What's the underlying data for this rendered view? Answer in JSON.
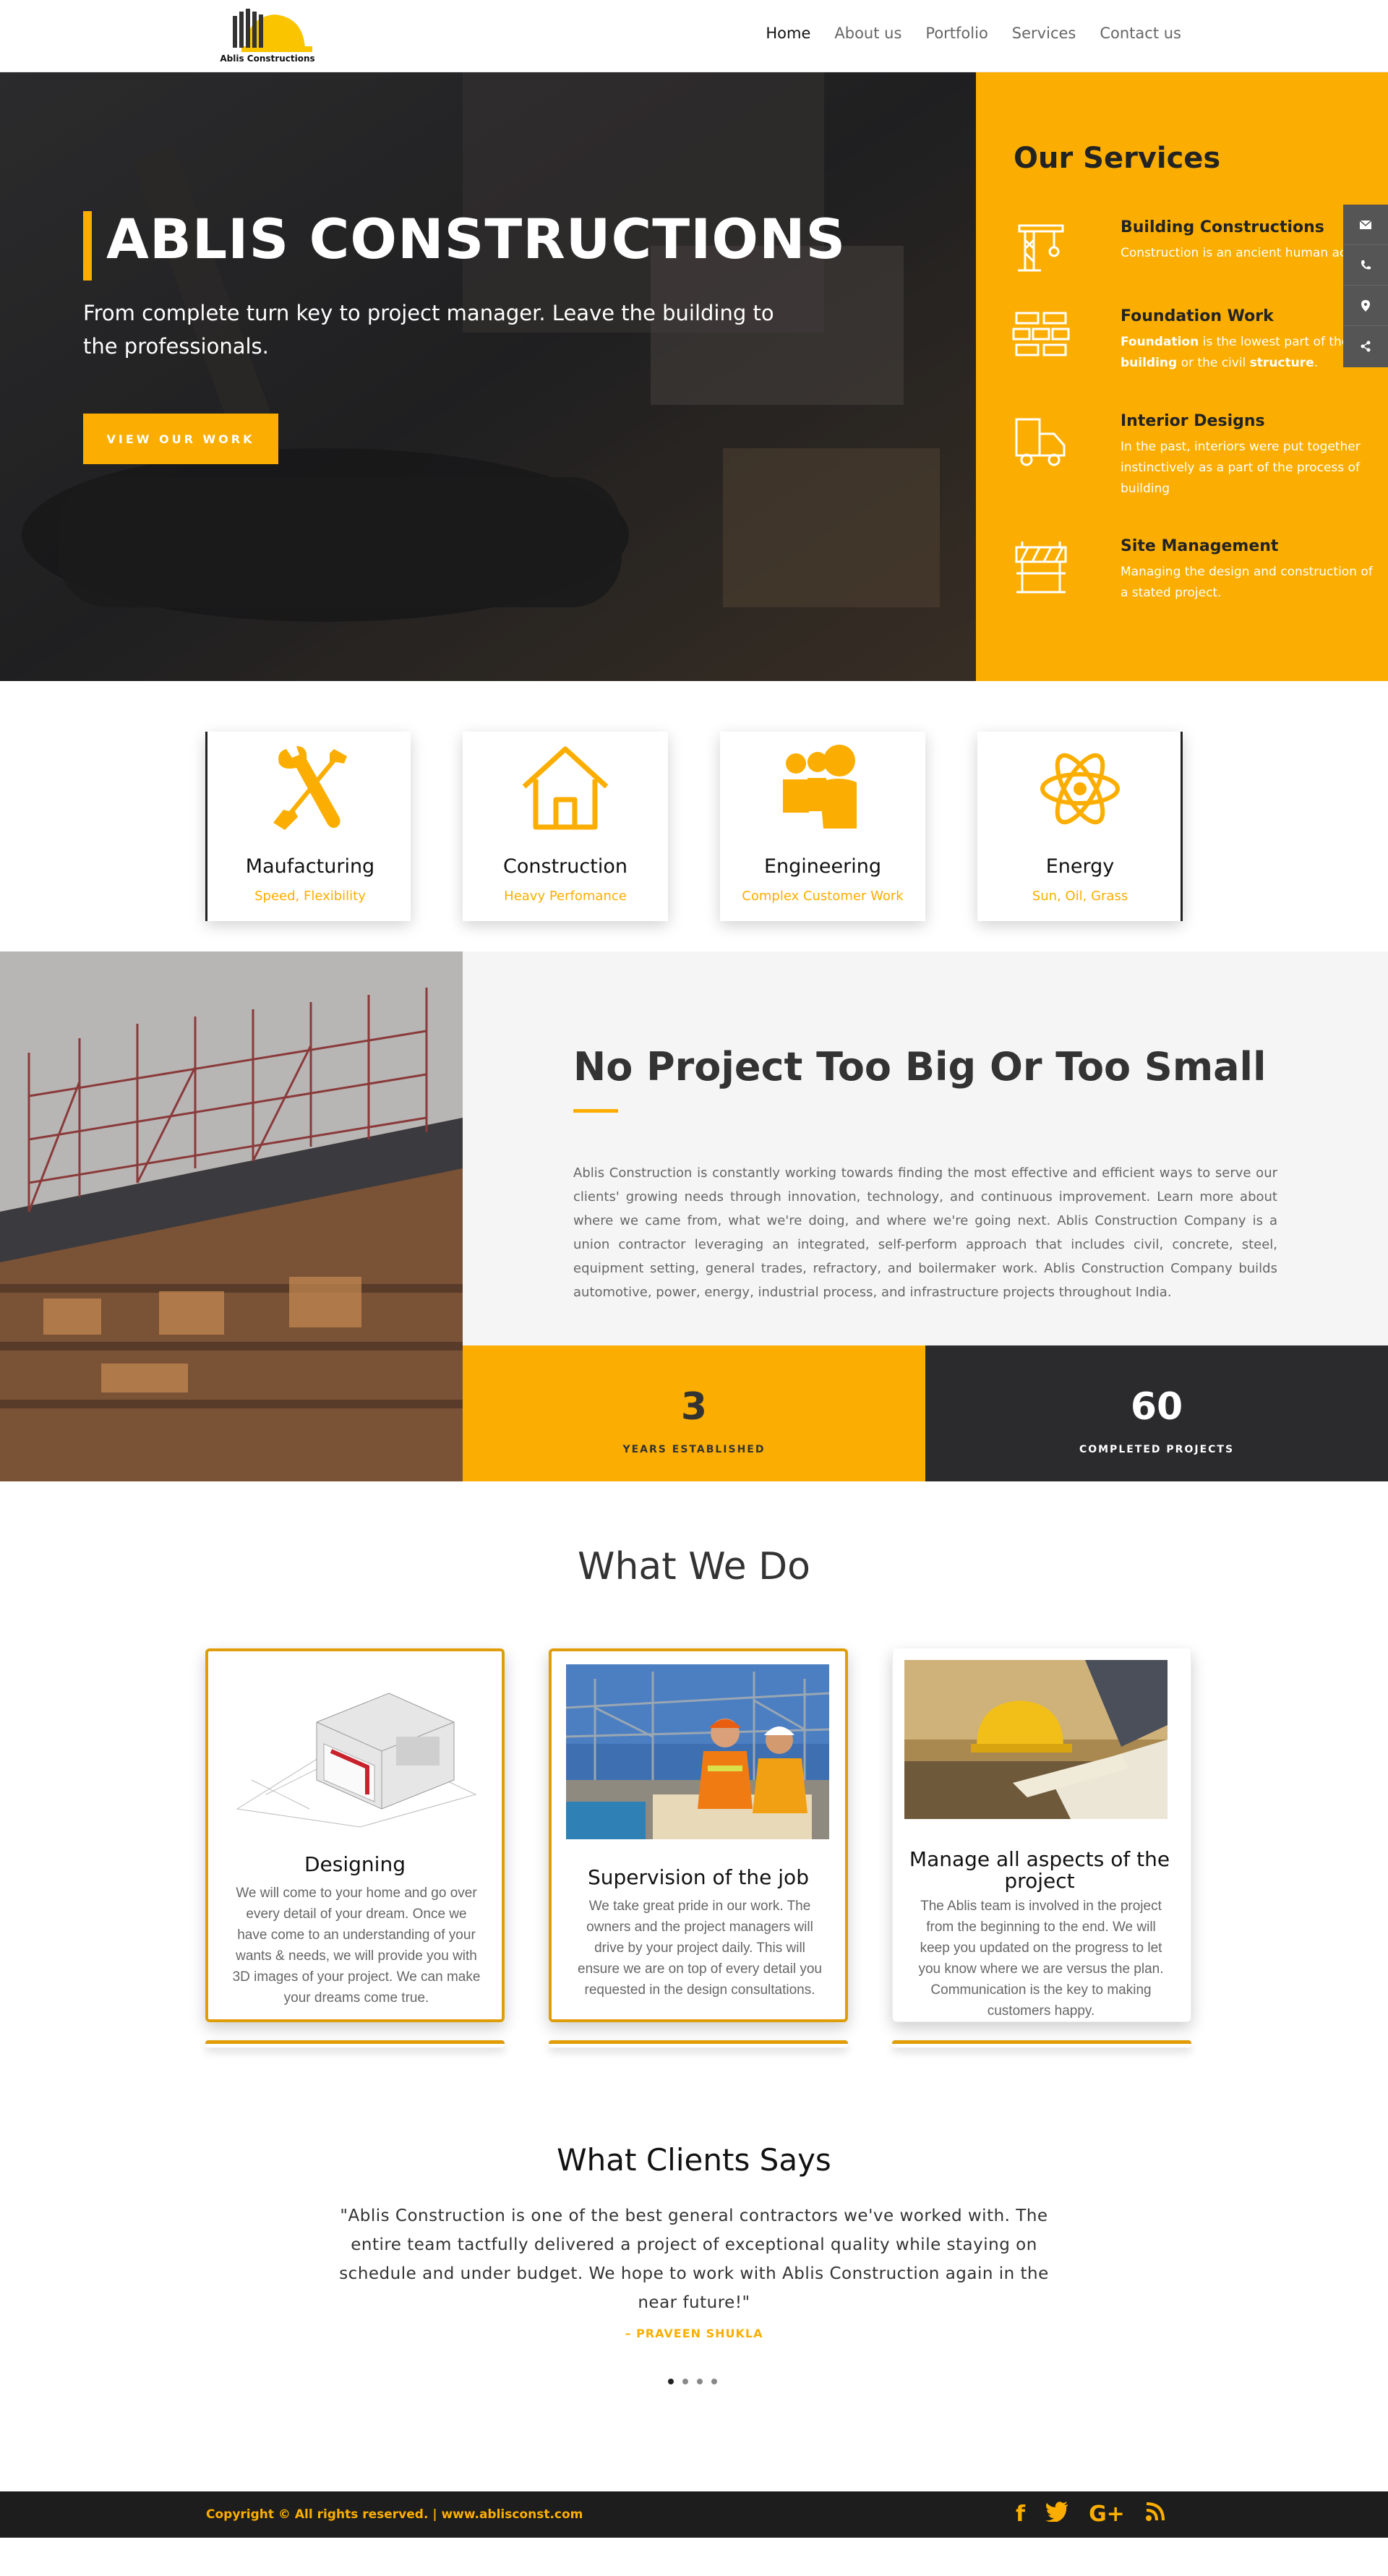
{
  "header": {
    "logo_text": "Ablis Constructions",
    "nav": [
      "Home",
      "About us",
      "Portfolio",
      "Services",
      "Contact us"
    ]
  },
  "hero": {
    "title": "ABLIS CONSTRUCTIONS",
    "subtitle": "From complete turn key to project manager. Leave the building to the professionals.",
    "button": "VIEW OUR WORK"
  },
  "services": {
    "title": "Our Services",
    "items": [
      {
        "name": "Building Constructions",
        "desc": "Construction is an ancient human activity",
        "icon": "crane-icon"
      },
      {
        "name": "Foundation Work",
        "desc_parts": [
          "Foundation",
          " is the lowest part of the ",
          "building",
          " or the civil ",
          "structure",
          "."
        ],
        "icon": "bricks-icon"
      },
      {
        "name": "Interior Designs",
        "desc": "In the past, interiors were put together instinctively as a part of the process of building",
        "icon": "truck-icon"
      },
      {
        "name": "Site Management",
        "desc": "Managing the design and construction of a stated project.",
        "icon": "barrier-icon"
      }
    ]
  },
  "side_tabs": [
    "envelope-icon",
    "phone-icon",
    "map-pin-icon",
    "share-icon"
  ],
  "features": [
    {
      "title": "Maufacturing",
      "sub": "Speed, Flexibility",
      "icon": "tools-icon"
    },
    {
      "title": "Construction",
      "sub": "Heavy Perfomance",
      "icon": "house-icon"
    },
    {
      "title": "Engineering",
      "sub": "Complex Customer Work",
      "icon": "team-icon"
    },
    {
      "title": "Energy",
      "sub": "Sun, Oil, Grass",
      "icon": "atom-icon"
    }
  ],
  "about": {
    "title": "No Project Too Big Or Too Small",
    "text": "Ablis Construction is constantly working towards finding the most effective and efficient ways to serve our clients' growing needs through innovation, technology, and continuous improvement. Learn more about where we came from, what we're doing, and where we're going next. Ablis Construction Company is a union contractor leveraging an integrated, self-perform approach that includes civil, concrete, steel, equipment setting, general trades, refractory, and boilermaker work. Ablis Construction Company builds automotive, power, energy, industrial process, and infrastructure projects throughout India.",
    "stats": [
      {
        "num": "3",
        "label": "YEARS ESTABLISHED"
      },
      {
        "num": "60",
        "label": "COMPLETED PROJECTS"
      }
    ]
  },
  "what_we_do": {
    "title": "What We Do",
    "cards": [
      {
        "name": "Designing",
        "desc": "We will come to your home and go over every detail of your dream. Once we have come to an understanding of your wants & needs, we will provide you with 3D images of your project. We can make your dreams come true."
      },
      {
        "name": "Supervision of the job",
        "desc": "We take great pride in our work. The owners and the project managers will drive by your project daily. This will ensure we are on top of every detail you requested in the design consultations."
      },
      {
        "name": "Manage all aspects of the project",
        "desc": "The Ablis team is involved in the project from the beginning to the end. We will keep you updated on the progress to let you know where we are versus the plan. Communication is the key to making customers happy."
      }
    ]
  },
  "testimonial": {
    "title": "What Clients Says",
    "quote": "\"Ablis Construction is one of the best general contractors we've worked with. The entire team tactfully delivered a project of exceptional quality while staying on schedule and under budget. We hope to work with Ablis Construction again in the near future!\"",
    "author": "– PRAVEEN SHUKLA"
  },
  "footer": {
    "copyright": "Copyright © All rights reserved. | www.ablisconst.com",
    "social": [
      "facebook-icon",
      "twitter-icon",
      "google-plus-icon",
      "rss-icon"
    ]
  },
  "colors": {
    "accent": "#fbae01",
    "dark": "#2b2b2e",
    "footer": "#1d1d1d"
  }
}
